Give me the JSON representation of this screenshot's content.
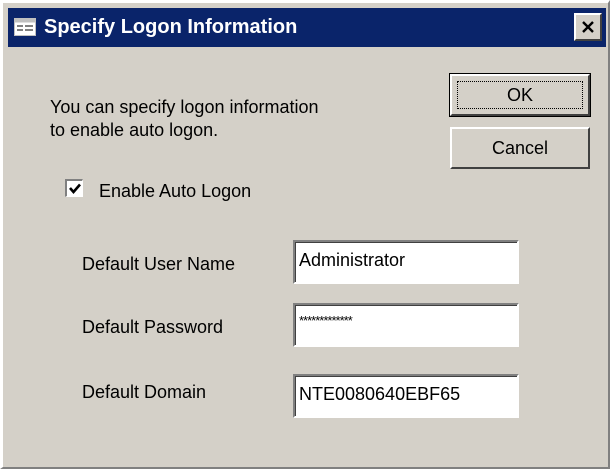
{
  "window": {
    "title": "Specify Logon Information",
    "close_glyph": "✕"
  },
  "message": {
    "line1": "You can specify logon information",
    "line2": "to enable auto logon."
  },
  "buttons": {
    "ok_label": "OK",
    "cancel_label": "Cancel"
  },
  "auto_logon": {
    "label": "Enable Auto Logon",
    "checked": true
  },
  "fields": {
    "user_label": "Default User Name",
    "user_value": "Administrator",
    "password_label": "Default Password",
    "password_value": "*************",
    "domain_label": "Default Domain",
    "domain_value": "NTE0080640EBF65"
  },
  "colors": {
    "titlebar": "#0a246a",
    "face": "#d4d0c8"
  },
  "icons": {
    "title": "dialog-icon",
    "close": "close-icon",
    "check": "check-icon"
  }
}
